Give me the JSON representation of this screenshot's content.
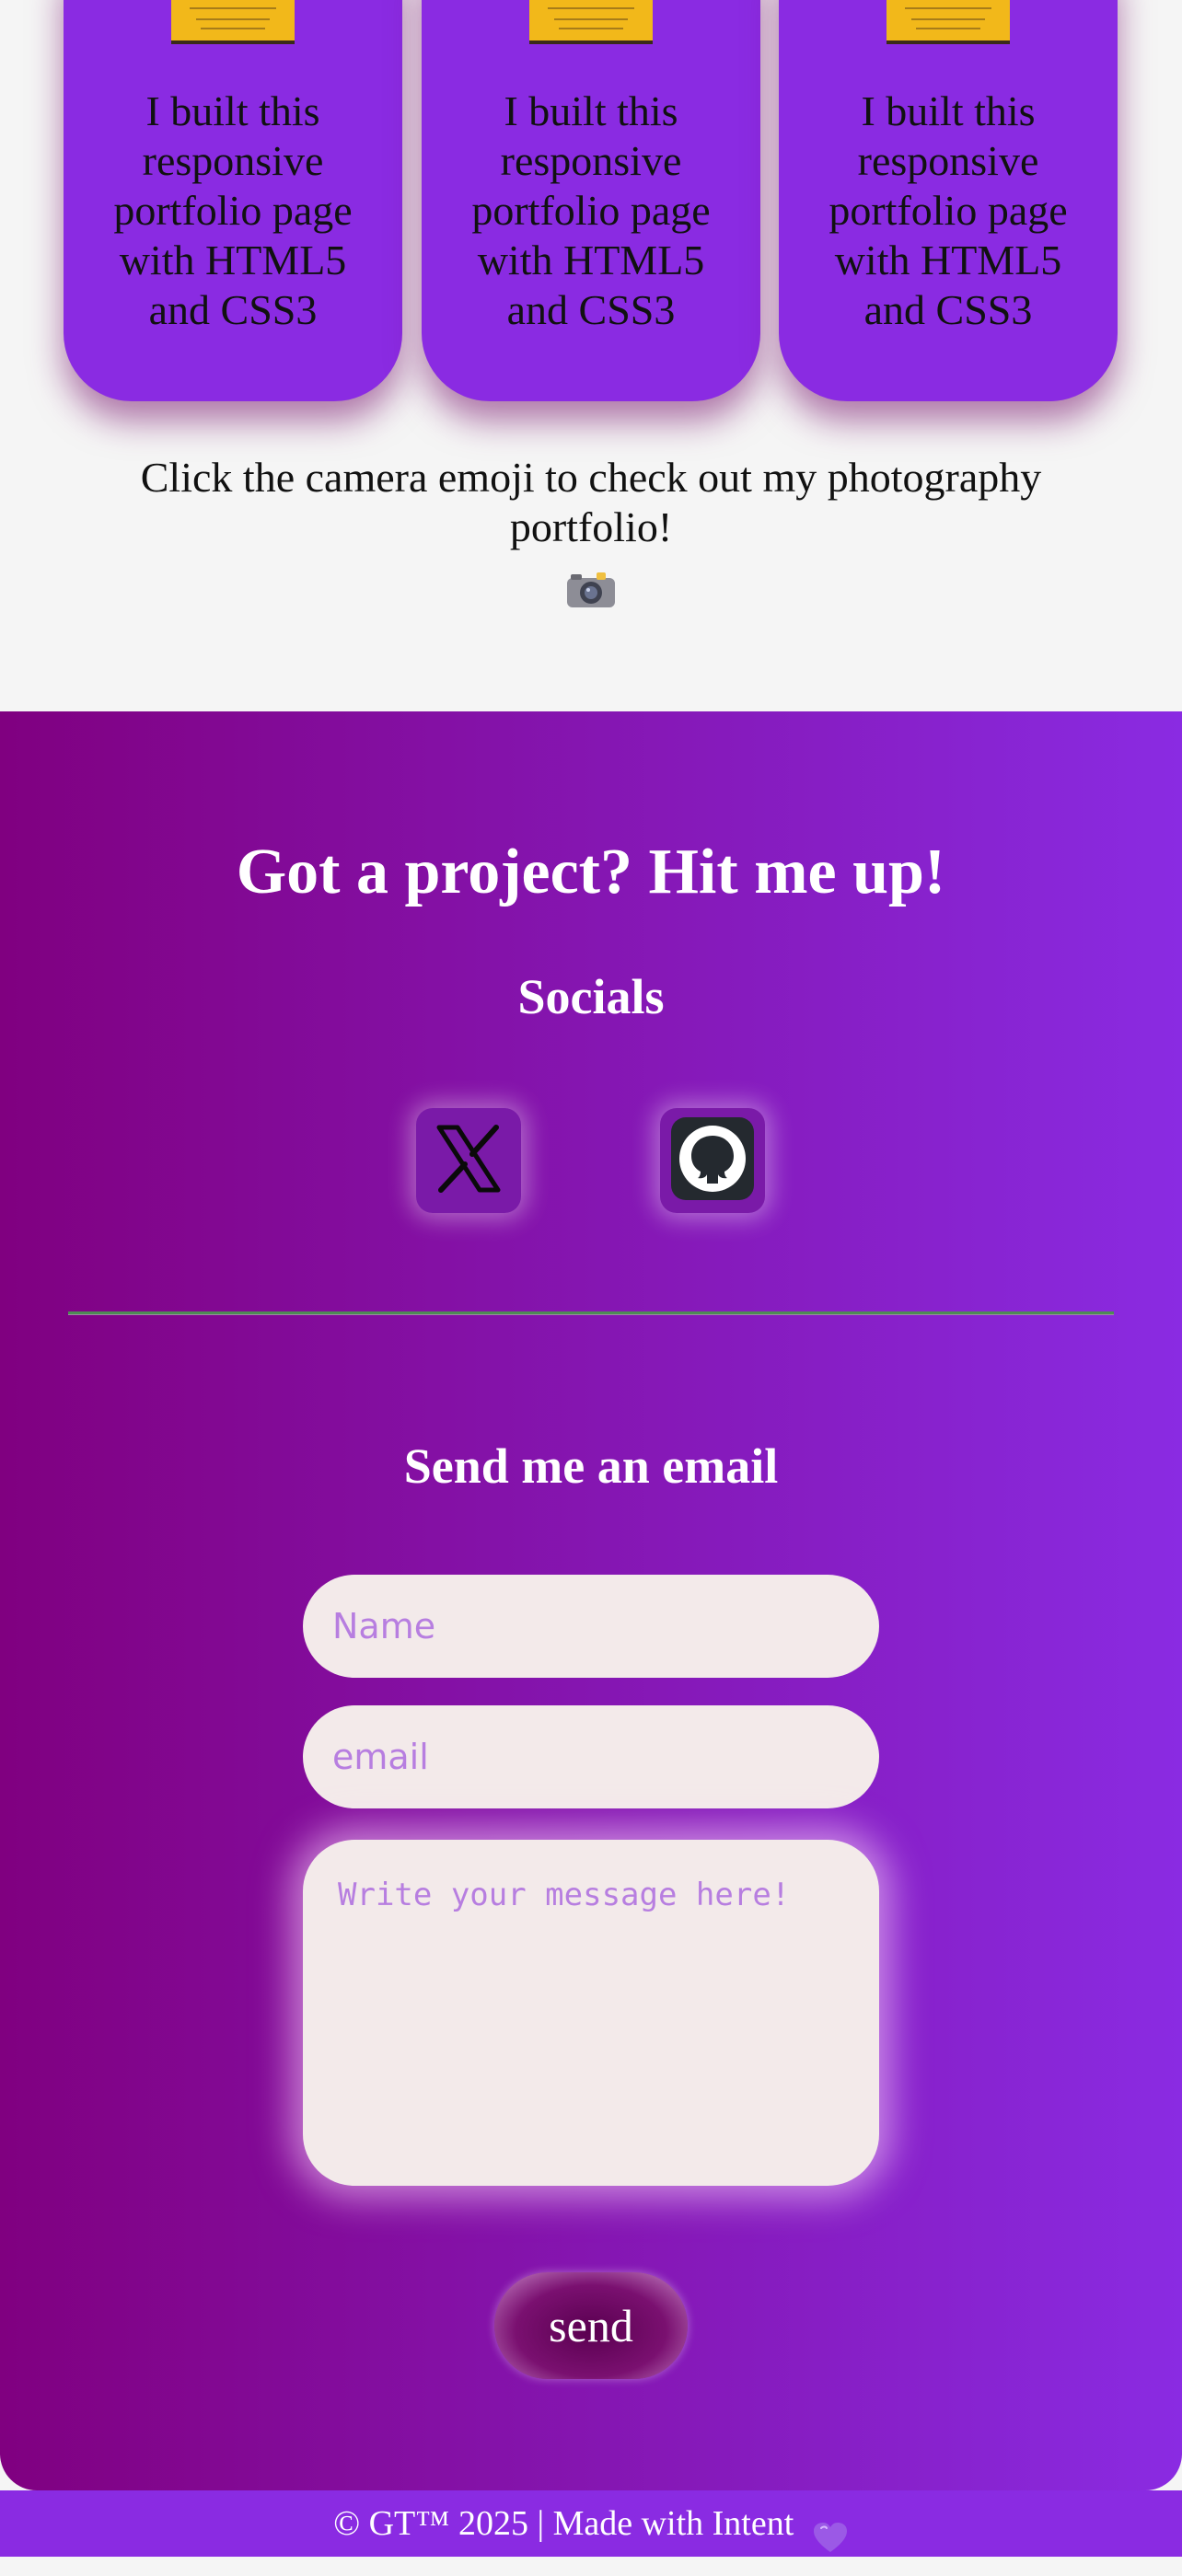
{
  "projects": {
    "cards": [
      {
        "description": "I built this responsive portfolio page with HTML5 and CSS3"
      },
      {
        "description": "I built this responsive portfolio page with HTML5 and CSS3"
      },
      {
        "description": "I built this responsive portfolio page with HTML5 and CSS3"
      }
    ],
    "photography_prompt": "Click the camera emoji to check out my photography portfolio!",
    "camera_icon": "camera-icon"
  },
  "contact": {
    "title": "Got a project? Hit me up!",
    "socials_title": "Socials",
    "socials": [
      {
        "name": "x",
        "icon": "x-logo-icon"
      },
      {
        "name": "github",
        "icon": "github-icon"
      }
    ],
    "email_title": "Send me an email",
    "form": {
      "name_placeholder": "Name",
      "email_placeholder": "email",
      "message_placeholder": "Write your message here!",
      "send_label": "send"
    }
  },
  "footer": {
    "text": "© GT™ 2025 | Made with Intent",
    "heart_icon": "purple-heart-icon"
  },
  "colors": {
    "card_purple": "#8a2be2",
    "gradient_start": "#800080",
    "gradient_end": "#8a2be2",
    "field_bg": "#f3eaea",
    "placeholder": "#b77ee0"
  }
}
